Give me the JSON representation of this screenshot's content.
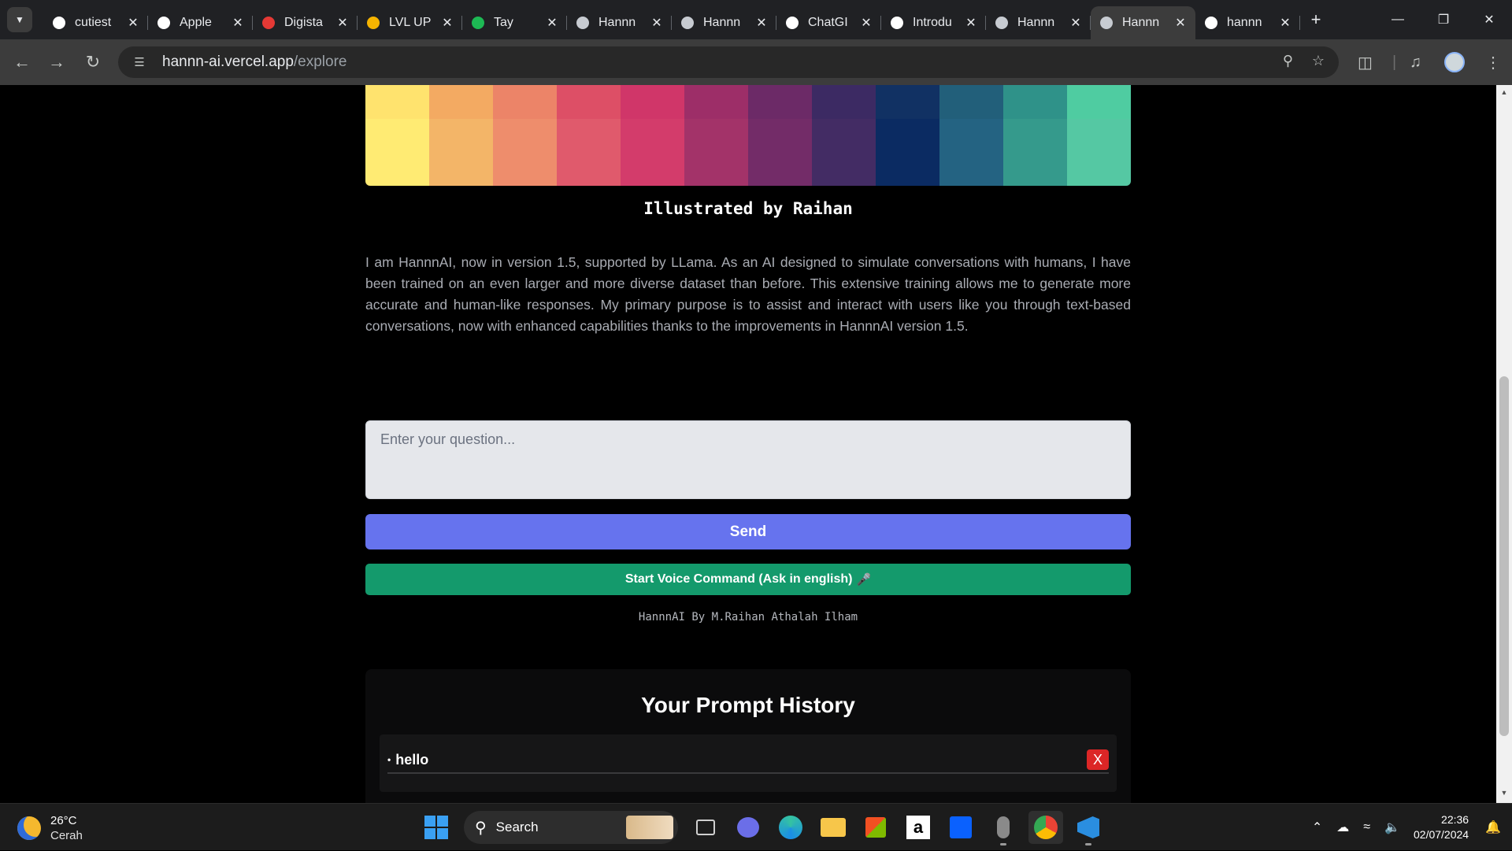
{
  "browser": {
    "tabs": [
      {
        "title": "cutiest",
        "icon": "github-icon",
        "color": "#ffffff"
      },
      {
        "title": "Apple",
        "icon": "apple-icon",
        "color": "#ffffff"
      },
      {
        "title": "Digista",
        "icon": "digistar-icon",
        "color": "#e53935"
      },
      {
        "title": "LVL UP",
        "icon": "slides-icon",
        "color": "#f6b400"
      },
      {
        "title": "Tay",
        "icon": "spotify-icon",
        "color": "#1db954"
      },
      {
        "title": "Hannn",
        "icon": "gear-icon",
        "color": "#c7cbd1"
      },
      {
        "title": "Hannn",
        "icon": "gear-icon",
        "color": "#c7cbd1"
      },
      {
        "title": "ChatGI",
        "icon": "openai-icon",
        "color": "#ffffff"
      },
      {
        "title": "Introdu",
        "icon": "openai-icon",
        "color": "#ffffff"
      },
      {
        "title": "Hannn",
        "icon": "gear-icon",
        "color": "#c7cbd1"
      },
      {
        "title": "Hannn",
        "icon": "gear-icon",
        "color": "#c7cbd1"
      },
      {
        "title": "hannn",
        "icon": "vercel-icon",
        "color": "#ffffff"
      }
    ],
    "active_tab_index": 10,
    "url_domain": "hannn-ai.vercel.app",
    "url_path": "/explore"
  },
  "page": {
    "palette": [
      {
        "top": "#ffe36e",
        "bottom": "#ffeb73"
      },
      {
        "top": "#f3aa62",
        "bottom": "#f3b568"
      },
      {
        "top": "#ec8468",
        "bottom": "#ee8d6c"
      },
      {
        "top": "#dd4f66",
        "bottom": "#e05a6c"
      },
      {
        "top": "#d03669",
        "bottom": "#d33c6b"
      },
      {
        "top": "#9d2e68",
        "bottom": "#a33369"
      },
      {
        "top": "#6c2a67",
        "bottom": "#732c68"
      },
      {
        "top": "#3c2a63",
        "bottom": "#432c64"
      },
      {
        "top": "#113163",
        "bottom": "#0b2b62"
      },
      {
        "top": "#225f7a",
        "bottom": "#246382"
      },
      {
        "top": "#2f9289",
        "bottom": "#359a8c"
      },
      {
        "top": "#4fcca1",
        "bottom": "#55c8a3"
      }
    ],
    "caption": "Illustrated by Raihan",
    "intro": "I am HannnAI, now in version 1.5, supported by LLama. As an AI designed to simulate conversations with humans, I have been trained on an even larger and more diverse dataset than before. This extensive training allows me to generate more accurate and human-like responses. My primary purpose is to assist and interact with users like you through text-based conversations, now with enhanced capabilities thanks to the improvements in HannnAI version 1.5.",
    "question_placeholder": "Enter your question...",
    "send_label": "Send",
    "voice_label": "Start Voice Command (Ask in english)",
    "credit": "HannnAI By M.Raihan Athalah Ilham",
    "history_title": "Your Prompt History",
    "history_items": [
      {
        "text": "hello",
        "delete_label": "X"
      }
    ]
  },
  "taskbar": {
    "temperature": "26°C",
    "condition": "Cerah",
    "search_label": "Search",
    "time": "22:36",
    "date": "02/07/2024"
  }
}
